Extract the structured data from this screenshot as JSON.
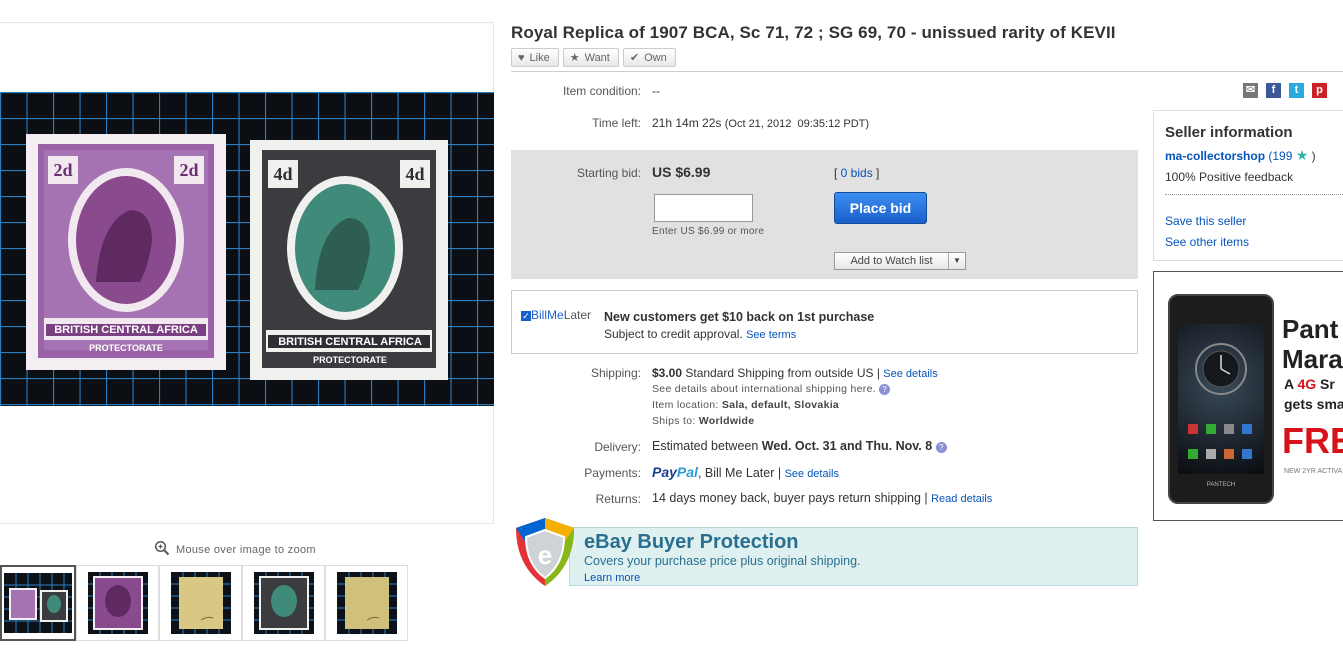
{
  "listing": {
    "title": "Royal Replica of 1907 BCA, Sc 71, 72 ; SG 69, 70 - unissued rarity of KEVII",
    "like": "Like",
    "want": "Want",
    "own": "Own"
  },
  "gallery": {
    "zoom_hint": "Mouse over image to zoom",
    "stamp_left": {
      "value": "2d",
      "name": "BRITISH CENTRAL AFRICA",
      "sub": "PROTECTORATE"
    },
    "stamp_right": {
      "value": "4d",
      "name": "BRITISH CENTRAL AFRICA",
      "sub": "PROTECTORATE"
    }
  },
  "details": {
    "condition_label": "Item condition:",
    "condition_value": "--",
    "time_left_label": "Time left:",
    "time_left_value": "21h 14m 22s",
    "time_left_end": "(Oct 21, 2012  09:35:12 PDT)",
    "starting_bid_label": "Starting bid:",
    "starting_bid_value": "US $6.99",
    "bids_link": "0 bids",
    "bid_hint": "Enter US $6.99 or more",
    "place_bid": "Place bid",
    "watch_list": "Add to Watch list"
  },
  "billmelater": {
    "logo_a": "Bill",
    "logo_b": "Me",
    "logo_c": "Later",
    "headline": "New customers get $10 back on 1st purchase",
    "sub": "Subject to credit approval.",
    "link": "See terms"
  },
  "shipping": {
    "label": "Shipping:",
    "price": "$3.00",
    "method": "Standard Shipping from outside US |",
    "link": "See details",
    "intl": "See details about international shipping here.",
    "location_label": "Item location:",
    "location": "Sala, default, Slovakia",
    "ships_to_label": "Ships to:",
    "ships_to": "Worldwide"
  },
  "delivery": {
    "label": "Delivery:",
    "text": "Estimated between",
    "dates": "Wed. Oct. 31 and Thu. Nov. 8"
  },
  "payments": {
    "label": "Payments:",
    "paypal_a": "Pay",
    "paypal_b": "Pal",
    "others": ", Bill Me Later |",
    "link": "See details"
  },
  "returns": {
    "label": "Returns:",
    "text": "14 days money back, buyer pays return shipping |",
    "link": "Read details"
  },
  "buyer_protection": {
    "title": "eBay Buyer Protection",
    "sub": "Covers your purchase price plus original shipping.",
    "link": "Learn more"
  },
  "seller": {
    "heading": "Seller information",
    "name": "ma-collectorshop",
    "score": "(199",
    "score_close": ")",
    "feedback": "100% Positive feedback",
    "save": "Save this seller",
    "other": "See other items"
  },
  "ad": {
    "line1": "Pant",
    "line2": "Mara",
    "line3a": "A ",
    "line3b": "4G",
    "line3c": " Sr",
    "line4": "gets smar",
    "line5": "FRE",
    "line6": "NEW 2YR ACTIVA",
    "brand": "PANTECH"
  },
  "colors": {
    "link": "#0654ba",
    "button": "#1a5fcc",
    "bid_bg": "#e1e1e1",
    "protection_bg": "#def0ef",
    "ad_red": "#d6131b"
  }
}
